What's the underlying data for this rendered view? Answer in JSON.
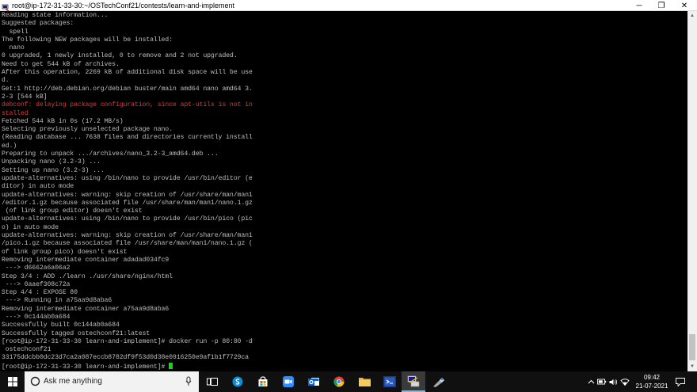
{
  "window": {
    "title": "root@ip-172-31-33-30:~/OSTechConf21/contests/learn-and-implement",
    "minimize_glyph": "─",
    "maximize_glyph": "❐",
    "close_glyph": "✕"
  },
  "terminal": {
    "lines": [
      {
        "text": "Reading state information...",
        "error": false
      },
      {
        "text": "Suggested packages:",
        "error": false
      },
      {
        "text": "  spell",
        "error": false
      },
      {
        "text": "The following NEW packages will be installed:",
        "error": false
      },
      {
        "text": "  nano",
        "error": false
      },
      {
        "text": "0 upgraded, 1 newly installed, 0 to remove and 2 not upgraded.",
        "error": false
      },
      {
        "text": "Need to get 544 kB of archives.",
        "error": false
      },
      {
        "text": "After this operation, 2269 kB of additional disk space will be use",
        "error": false
      },
      {
        "text": "d.",
        "error": false
      },
      {
        "text": "Get:1 http://deb.debian.org/debian buster/main amd64 nano amd64 3.",
        "error": false
      },
      {
        "text": "2-3 [544 kB]",
        "error": false
      },
      {
        "text": "debconf: delaying package configuration, since apt-utils is not in",
        "error": true
      },
      {
        "text": "stalled",
        "error": true
      },
      {
        "text": "Fetched 544 kB in 0s (17.2 MB/s)",
        "error": false
      },
      {
        "text": "Selecting previously unselected package nano.",
        "error": false
      },
      {
        "text": "(Reading database ... 7638 files and directories currently install",
        "error": false
      },
      {
        "text": "ed.)",
        "error": false
      },
      {
        "text": "Preparing to unpack .../archives/nano_3.2-3_amd64.deb ...",
        "error": false
      },
      {
        "text": "Unpacking nano (3.2-3) ...",
        "error": false
      },
      {
        "text": "Setting up nano (3.2-3) ...",
        "error": false
      },
      {
        "text": "update-alternatives: using /bin/nano to provide /usr/bin/editor (e",
        "error": false
      },
      {
        "text": "ditor) in auto mode",
        "error": false
      },
      {
        "text": "update-alternatives: warning: skip creation of /usr/share/man/man1",
        "error": false
      },
      {
        "text": "/editor.1.gz because associated file /usr/share/man/man1/nano.1.gz",
        "error": false
      },
      {
        "text": " (of link group editor) doesn't exist",
        "error": false
      },
      {
        "text": "update-alternatives: using /bin/nano to provide /usr/bin/pico (pic",
        "error": false
      },
      {
        "text": "o) in auto mode",
        "error": false
      },
      {
        "text": "update-alternatives: warning: skip creation of /usr/share/man/man1",
        "error": false
      },
      {
        "text": "/pico.1.gz because associated file /usr/share/man/man1/nano.1.gz (",
        "error": false
      },
      {
        "text": "of link group pico) doesn't exist",
        "error": false
      },
      {
        "text": "Removing intermediate container adadad034fc9",
        "error": false
      },
      {
        "text": " ---> d6662a6a06a2",
        "error": false
      },
      {
        "text": "Step 3/4 : ADD ./learn ./usr/share/nginx/html",
        "error": false
      },
      {
        "text": " ---> 0aaef308c72a",
        "error": false
      },
      {
        "text": "Step 4/4 : EXPOSE 80",
        "error": false
      },
      {
        "text": " ---> Running in a75aa9d8aba6",
        "error": false
      },
      {
        "text": "Removing intermediate container a75aa9d8aba6",
        "error": false
      },
      {
        "text": " ---> 0c144ab0a684",
        "error": false
      },
      {
        "text": "Successfully built 0c144ab0a684",
        "error": false
      },
      {
        "text": "Successfully tagged ostechconf21:latest",
        "error": false
      },
      {
        "text": "[root@ip-172-31-33-30 learn-and-implement]# docker run -p 80:80 -d",
        "error": false
      },
      {
        "text": " ostechconf21",
        "error": false
      },
      {
        "text": "33175ddcbb0dc23d7ca2a087eccb8782df9f53d0d38e0916250e9af1b1f7729ca",
        "error": false
      }
    ],
    "prompt": "[root@ip-172-31-33-30 learn-and-implement]# "
  },
  "taskbar": {
    "search_placeholder": "Ask me anything",
    "pinned_icons": [
      "task-view-icon",
      "skype-icon",
      "store-icon",
      "zoom-icon",
      "outlook-icon",
      "chrome-icon",
      "file-explorer-icon",
      "vscode-icon",
      "putty-icon",
      "other-app-icon"
    ],
    "active_app": "putty-icon",
    "clock_time": "09:42",
    "clock_date": "21-07-2021"
  },
  "colors": {
    "terminal_bg": "#000000",
    "terminal_fg": "#c0c0c0",
    "error_fg": "#e03c31",
    "cursor": "#19d219",
    "taskbar_bg": "#101010",
    "accent": "#76b9ed"
  }
}
